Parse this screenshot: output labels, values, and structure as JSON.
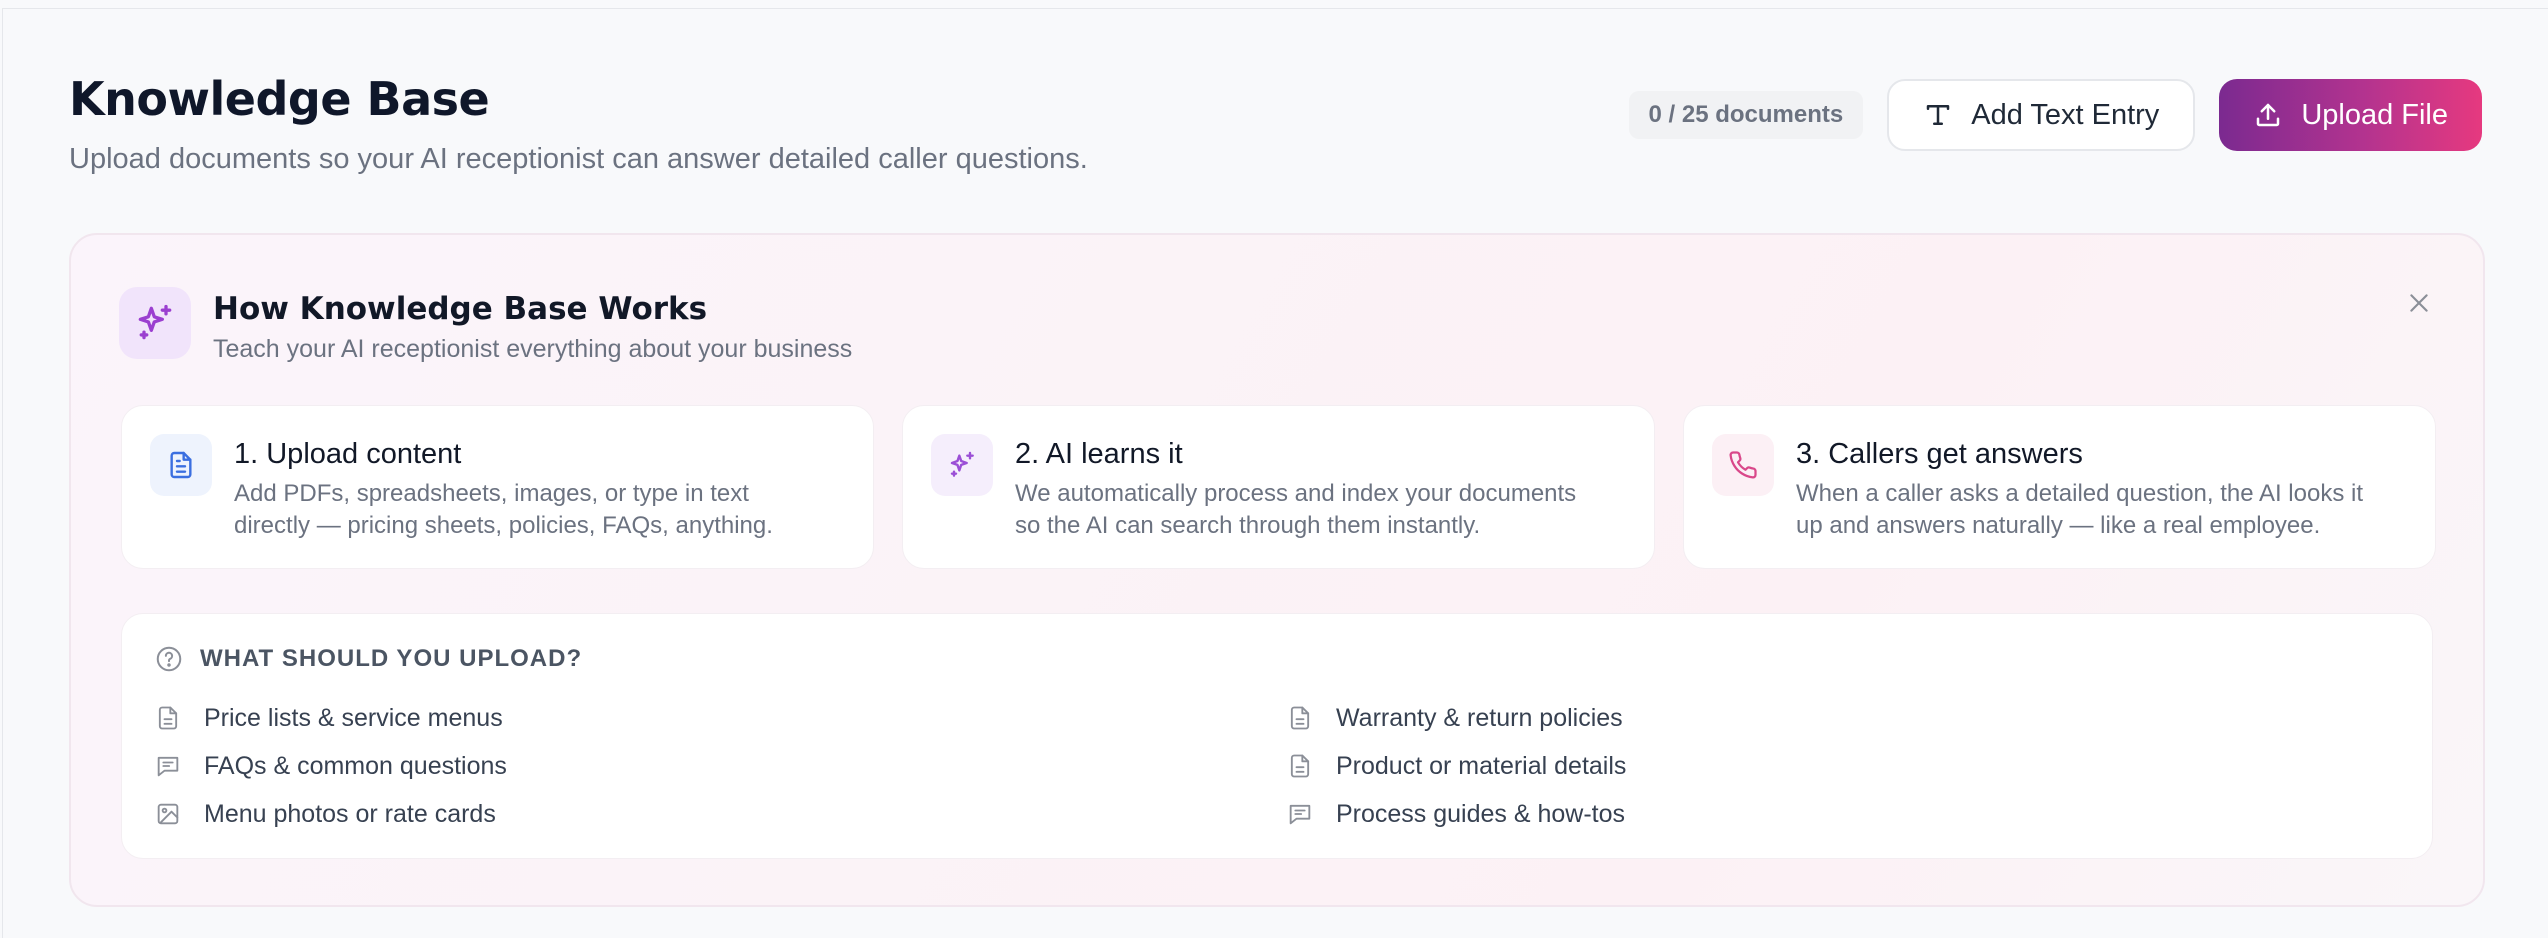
{
  "header": {
    "title": "Knowledge Base",
    "subtitle": "Upload documents so your AI receptionist can answer detailed caller questions.",
    "doc_count": "0 / 25 documents",
    "add_text_label": "Add Text Entry",
    "upload_label": "Upload File"
  },
  "panel": {
    "title": "How Knowledge Base Works",
    "subtitle": "Teach your AI receptionist everything about your business",
    "steps": [
      {
        "title": "1. Upload content",
        "desc_line1": "Add PDFs, spreadsheets, images, or type in text",
        "desc_line2": "directly — pricing sheets, policies, FAQs, anything.",
        "icon": "document-icon"
      },
      {
        "title": "2. AI learns it",
        "desc_line1": "We automatically process and index your documents",
        "desc_line2": "so the AI can search through them instantly.",
        "icon": "sparkle-icon"
      },
      {
        "title": "3. Callers get answers",
        "desc_line1": "When a caller asks a detailed question, the AI looks it",
        "desc_line2": "up and answers naturally — like a real employee.",
        "icon": "phone-icon"
      }
    ],
    "upload_heading": "WHAT SHOULD YOU UPLOAD?",
    "upload_items_left": [
      {
        "label": "Price lists & service menus",
        "icon": "document-icon"
      },
      {
        "label": "FAQs & common questions",
        "icon": "chat-icon"
      },
      {
        "label": "Menu photos or rate cards",
        "icon": "image-icon"
      }
    ],
    "upload_items_right": [
      {
        "label": "Warranty & return policies",
        "icon": "document-icon"
      },
      {
        "label": "Product or material details",
        "icon": "document-icon"
      },
      {
        "label": "Process guides & how-tos",
        "icon": "chat-icon"
      }
    ]
  },
  "colors": {
    "accent_purple": "#7b2a90",
    "accent_pink": "#e6397f",
    "step1_icon": "#3b6fe0",
    "step2_icon": "#9b4fd6",
    "step3_icon": "#d9488a"
  }
}
